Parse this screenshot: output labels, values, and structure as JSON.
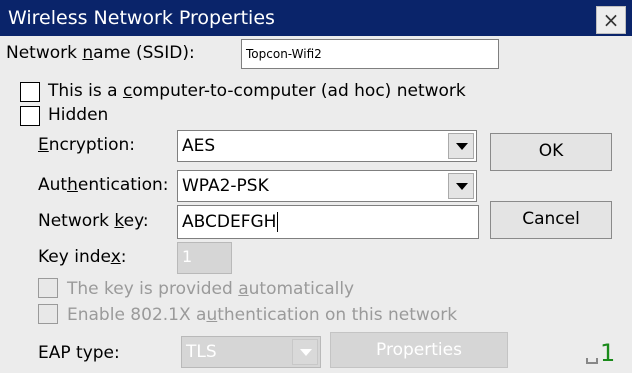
{
  "window": {
    "title": "Wireless Network Properties",
    "close_glyph": "×"
  },
  "ssid": {
    "label_pre": "Network ",
    "label_key": "n",
    "label_post": "ame (SSID):",
    "value": "Topcon-Wifi2"
  },
  "adhoc": {
    "label_pre": "This is a ",
    "label_key": "c",
    "label_post": "omputer-to-computer (ad hoc) network",
    "checked": false
  },
  "hidden": {
    "label": "Hidden",
    "checked": false
  },
  "encryption": {
    "label_key": "E",
    "label_post": "ncryption:",
    "value": "AES"
  },
  "authentication": {
    "label_pre": "Aut",
    "label_key": "h",
    "label_post": "entication:",
    "value": "WPA2-PSK"
  },
  "network_key": {
    "label_pre": "Network ",
    "label_key": "k",
    "label_post": "ey:",
    "value": "ABCDEFGH"
  },
  "key_index": {
    "label_pre": "Key inde",
    "label_key": "x",
    "label_post": ":",
    "value": "1",
    "enabled": false
  },
  "auto_key": {
    "label_pre": "The key is provided ",
    "label_key": "a",
    "label_post": "utomatically",
    "checked": false,
    "enabled": false
  },
  "enable_8021x": {
    "label_pre": "Enable 802.1X a",
    "label_key": "u",
    "label_post": "thentication on this network",
    "checked": false,
    "enabled": false
  },
  "eap": {
    "label": "EAP type:",
    "value": "TLS",
    "enabled": false,
    "properties_label": "Properties"
  },
  "buttons": {
    "ok": "OK",
    "cancel": "Cancel"
  },
  "status_indicator": "1"
}
